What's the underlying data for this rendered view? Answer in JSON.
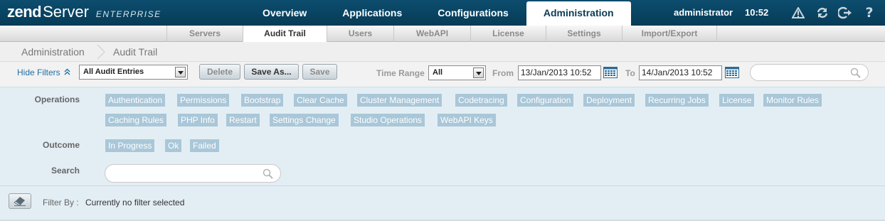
{
  "app": {
    "logo_zend": "zend",
    "logo_server": "Server",
    "logo_edition": "ENTERPRISE",
    "user": "administrator",
    "time": "10:52"
  },
  "main_tabs": [
    {
      "label": "Overview"
    },
    {
      "label": "Applications"
    },
    {
      "label": "Configurations"
    },
    {
      "label": "Administration",
      "active": true
    }
  ],
  "top_icons": [
    "warning-icon",
    "refresh-icon",
    "logout-icon",
    "help-icon"
  ],
  "sub_nav": [
    {
      "label": "Servers"
    },
    {
      "label": "Audit Trail",
      "active": true
    },
    {
      "label": "Users"
    },
    {
      "label": "WebAPI"
    },
    {
      "label": "License"
    },
    {
      "label": "Settings"
    },
    {
      "label": "Import/Export"
    }
  ],
  "breadcrumb": [
    "Administration",
    "Audit Trail"
  ],
  "toolbar": {
    "hide_filters": "Hide Filters",
    "entries_select": "All Audit Entries",
    "delete_label": "Delete",
    "save_as_label": "Save As...",
    "save_label": "Save",
    "time_range_label": "Time Range",
    "time_range_value": "All",
    "from_label": "From",
    "from_value": "13/Jan/2013 10:52",
    "to_label": "To",
    "to_value": "14/Jan/2013 10:52",
    "search_placeholder": ""
  },
  "filters": {
    "operations_label": "Operations",
    "operations": [
      "Authentication",
      "Permissions",
      "Bootstrap",
      "Clear Cache",
      "Cluster Management",
      "Codetracing",
      "Configuration",
      "Deployment",
      "Recurring Jobs",
      "License",
      "Monitor Rules",
      "Caching Rules",
      "PHP Info",
      "Restart",
      "Settings Change",
      "Studio Operations",
      "WebAPI Keys"
    ],
    "outcome_label": "Outcome",
    "outcomes": [
      "In Progress",
      "Ok",
      "Failed"
    ],
    "search_label": "Search",
    "search_placeholder": ""
  },
  "filter_by": {
    "label": "Filter By :",
    "value": "Currently no filter selected"
  }
}
